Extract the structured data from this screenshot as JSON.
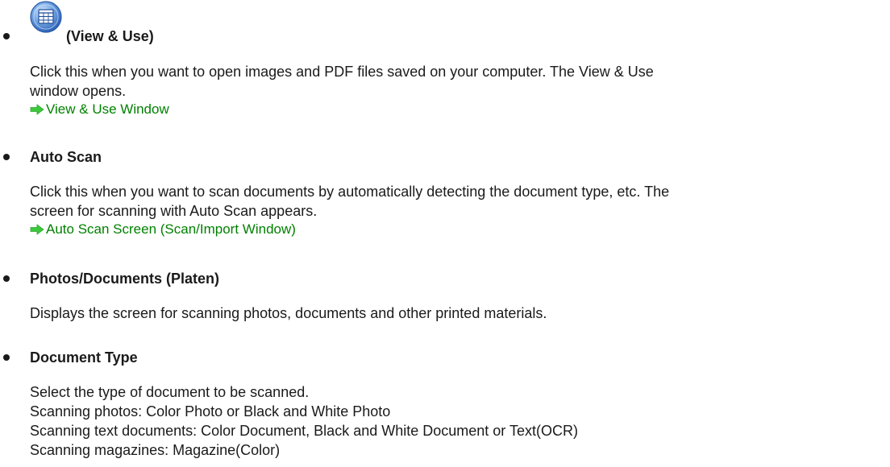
{
  "sections": [
    {
      "heading": "(View & Use)",
      "icon": "view-and-use-icon",
      "lines": [
        "Click this when you want to open images and PDF files saved on your computer. The View & Use",
        "window opens."
      ],
      "link": "View & Use Window"
    },
    {
      "heading": "Auto Scan",
      "lines": [
        "Click this when you want to scan documents by automatically detecting the document type, etc. The",
        "screen for scanning with Auto Scan appears."
      ],
      "link": "Auto Scan Screen (Scan/Import Window)"
    },
    {
      "heading": "Photos/Documents (Platen)",
      "lines": [
        "Displays the screen for scanning photos, documents and other printed materials."
      ]
    },
    {
      "heading": "Document Type",
      "lines": [
        "Select the type of document to be scanned.",
        "Scanning photos: Color Photo or Black and White Photo",
        "Scanning text documents: Color Document, Black and White Document or Text(OCR)",
        "Scanning magazines: Magazine(Color)"
      ]
    }
  ],
  "colors": {
    "link": "#008000",
    "arrow": "#3cc83c",
    "text": "#1a1a1a"
  }
}
